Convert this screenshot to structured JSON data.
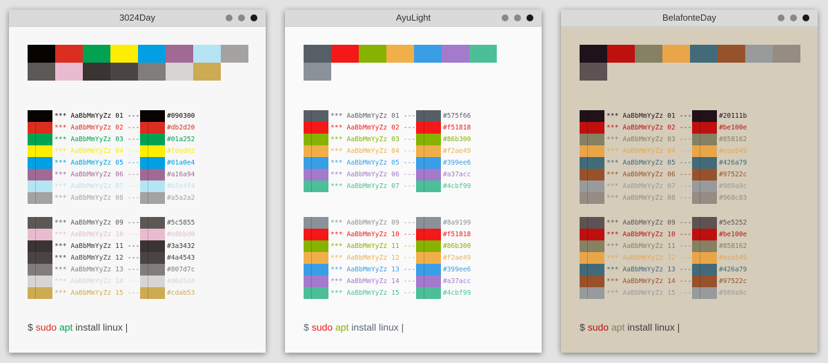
{
  "sample_text": "*** AaBbMmYyZz",
  "windows": [
    {
      "title": "3024Day",
      "bg": "#f7f7f7",
      "fg": "#4a4543",
      "palette_top": [
        "#090300",
        "#db2d20",
        "#01a252",
        "#fded02",
        "#01a0e4",
        "#a16a94",
        "#b5e4f4",
        "#a5a2a2"
      ],
      "palette_bottom": [
        "#5c5855",
        "#e8bbd0",
        "#3a3432",
        "#4a4543",
        "#807d7c",
        "#d6d5d4",
        "#cdab53"
      ],
      "group1": [
        {
          "num": "01",
          "hex": "#090300"
        },
        {
          "num": "02",
          "hex": "#db2d20"
        },
        {
          "num": "03",
          "hex": "#01a252"
        },
        {
          "num": "04",
          "hex": "#fded02"
        },
        {
          "num": "05",
          "hex": "#01a0e4"
        },
        {
          "num": "06",
          "hex": "#a16a94"
        },
        {
          "num": "07",
          "hex": "#b5e4f4"
        },
        {
          "num": "08",
          "hex": "#a5a2a2"
        }
      ],
      "group2": [
        {
          "num": "09",
          "hex": "#5c5855"
        },
        {
          "num": "10",
          "hex": "#e8bbd0"
        },
        {
          "num": "11",
          "hex": "#3a3432"
        },
        {
          "num": "12",
          "hex": "#4a4543"
        },
        {
          "num": "13",
          "hex": "#807d7c"
        },
        {
          "num": "14",
          "hex": "#d6d5d4"
        },
        {
          "num": "15",
          "hex": "#cdab53"
        }
      ],
      "prompt": {
        "dollar": "$ ",
        "sudo": "sudo",
        "apt": "apt",
        "rest": " install linux |",
        "sudo_color": "#db2d20",
        "apt_color": "#01a252"
      }
    },
    {
      "title": "AyuLight",
      "bg": "#fafafa",
      "fg": "#5c6773",
      "palette_top": [
        "#575f66",
        "#f51818",
        "#86b300",
        "#f2ae49",
        "#399ee6",
        "#a37acc",
        "#4cbf99"
      ],
      "palette_bottom": [
        "#8a9199"
      ],
      "group1": [
        {
          "num": "01",
          "hex": "#575f66"
        },
        {
          "num": "02",
          "hex": "#f51818"
        },
        {
          "num": "03",
          "hex": "#86b300"
        },
        {
          "num": "04",
          "hex": "#f2ae49"
        },
        {
          "num": "05",
          "hex": "#399ee6"
        },
        {
          "num": "06",
          "hex": "#a37acc"
        },
        {
          "num": "07",
          "hex": "#4cbf99"
        }
      ],
      "group2": [
        {
          "num": "09",
          "hex": "#8a9199"
        },
        {
          "num": "10",
          "hex": "#f51818"
        },
        {
          "num": "11",
          "hex": "#86b300"
        },
        {
          "num": "12",
          "hex": "#f2ae49"
        },
        {
          "num": "13",
          "hex": "#399ee6"
        },
        {
          "num": "14",
          "hex": "#a37acc"
        },
        {
          "num": "15",
          "hex": "#4cbf99"
        }
      ],
      "prompt": {
        "dollar": "$ ",
        "sudo": "sudo",
        "apt": "apt",
        "rest": " install linux |",
        "sudo_color": "#f51818",
        "apt_color": "#86b300"
      }
    },
    {
      "title": "BelafonteDay",
      "bg": "#d5ccba",
      "fg": "#45373c",
      "palette_top": [
        "#20111b",
        "#be100e",
        "#858162",
        "#eaa549",
        "#426a79",
        "#97522c",
        "#989a9c",
        "#968c83"
      ],
      "palette_bottom": [
        "#5e5252"
      ],
      "group1": [
        {
          "num": "01",
          "hex": "#20111b"
        },
        {
          "num": "02",
          "hex": "#be100e"
        },
        {
          "num": "03",
          "hex": "#858162"
        },
        {
          "num": "04",
          "hex": "#eaa549"
        },
        {
          "num": "05",
          "hex": "#426a79"
        },
        {
          "num": "06",
          "hex": "#97522c"
        },
        {
          "num": "07",
          "hex": "#989a9c"
        },
        {
          "num": "08",
          "hex": "#968c83"
        }
      ],
      "group2": [
        {
          "num": "09",
          "hex": "#5e5252"
        },
        {
          "num": "10",
          "hex": "#be100e"
        },
        {
          "num": "11",
          "hex": "#858162"
        },
        {
          "num": "12",
          "hex": "#eaa549"
        },
        {
          "num": "13",
          "hex": "#426a79"
        },
        {
          "num": "14",
          "hex": "#97522c"
        },
        {
          "num": "15",
          "hex": "#989a9c"
        }
      ],
      "prompt": {
        "dollar": "$ ",
        "sudo": "sudo",
        "apt": "apt",
        "rest": " install linux |",
        "sudo_color": "#be100e",
        "apt_color": "#858162"
      }
    }
  ]
}
